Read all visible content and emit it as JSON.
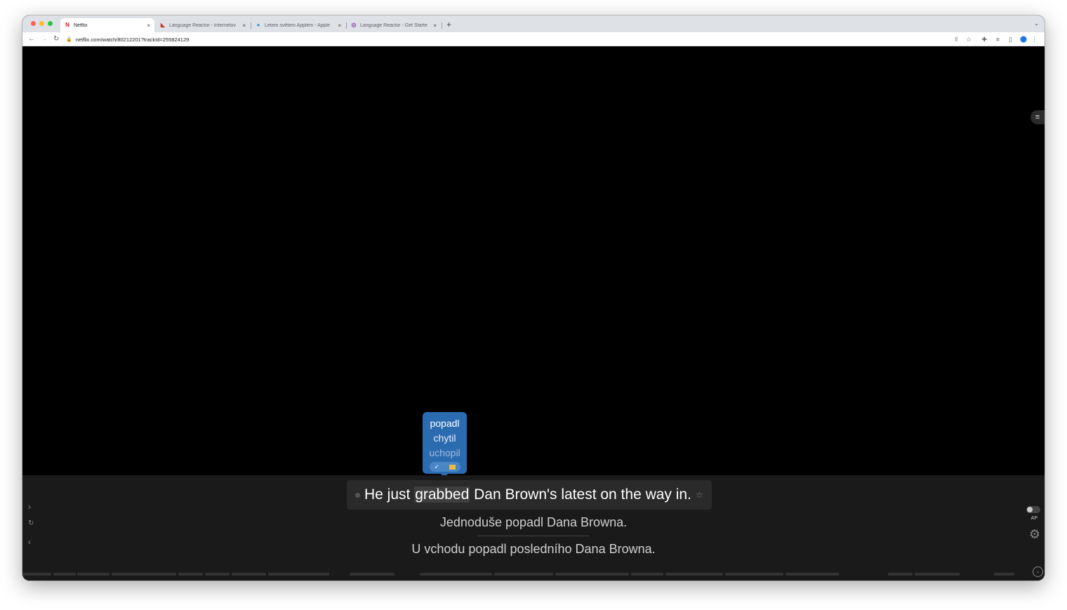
{
  "browser": {
    "tabs": [
      {
        "title": "Netflix",
        "favicon": "netflix-icon",
        "active": true
      },
      {
        "title": "Language Reactor - Internetov",
        "favicon": "language-reactor-icon",
        "active": false
      },
      {
        "title": "Letem světem Applem - Apple",
        "favicon": "globe-icon",
        "active": false
      },
      {
        "title": "Language Reactor - Get Starte",
        "favicon": "language-reactor-icon",
        "active": false
      }
    ],
    "url": "netflix.com/watch/80212201?trackId=255824129"
  },
  "subtitles": {
    "main_before": "He just ",
    "main_highlight": "grabbed",
    "main_after": " Dan Brown's latest on the way in.",
    "translation_1": "Jednoduše popadl Dana Browna.",
    "translation_2": "U vchodu popadl posledního Dana Browna."
  },
  "popup": {
    "word_1": "popadl",
    "word_2": "chytil",
    "word_3": "uchopil"
  },
  "controls": {
    "ap_label": "AP"
  },
  "colors": {
    "popup_bg": "#2b6cb0",
    "panel_bg": "#1a1a1a"
  }
}
